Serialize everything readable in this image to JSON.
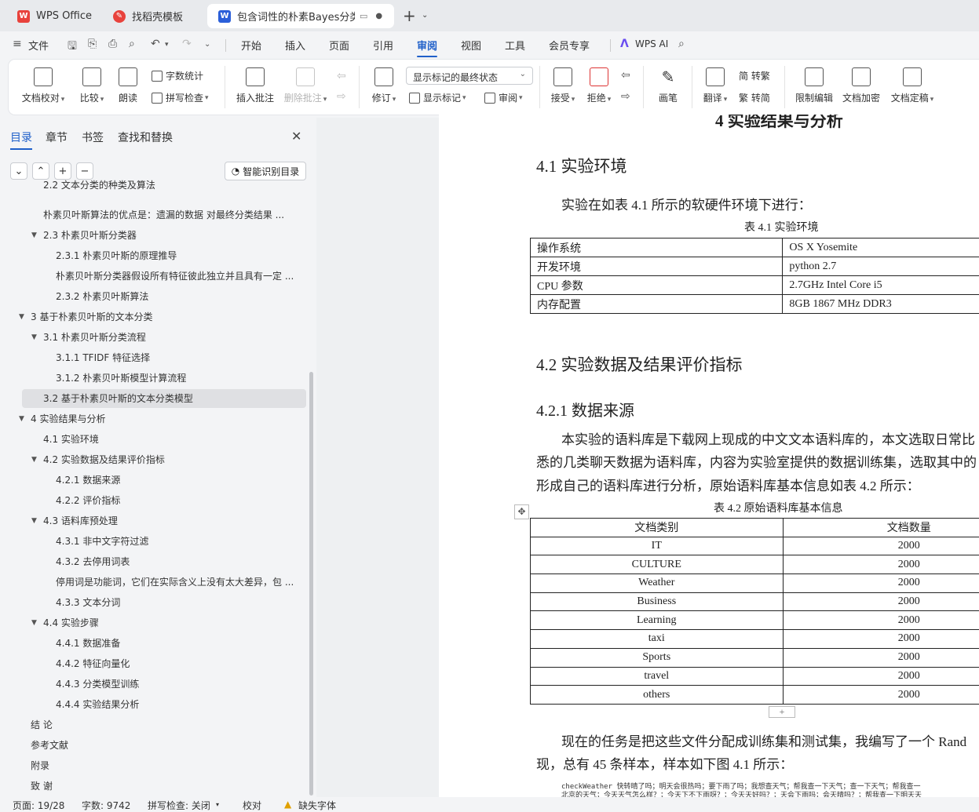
{
  "tabs": [
    {
      "label": "WPS Office"
    },
    {
      "label": "找稻壳模板"
    },
    {
      "label": "包含词性的朴素Bayes分类在文"
    }
  ],
  "menu": {
    "file": "文件",
    "start": "开始",
    "insert": "插入",
    "page": "页面",
    "reference": "引用",
    "review": "审阅",
    "view": "视图",
    "tools": "工具",
    "member": "会员专享",
    "ai": "WPS AI"
  },
  "ribbon": {
    "doc_check": "文档校对",
    "compare": "比较",
    "read": "朗读",
    "word_count": "字数统计",
    "spell_check": "拼写检查",
    "insert_comment": "插入批注",
    "delete_comment": "删除批注",
    "revise": "修订",
    "markup_select": "显示标记的最终状态",
    "show_markup": "显示标记",
    "review_pane": "审阅",
    "accept": "接受",
    "reject": "拒绝",
    "pen": "画笔",
    "translate": "翻译",
    "to_traditional": "简 转繁",
    "to_simplified": "繁 转简",
    "restrict": "限制编辑",
    "encrypt": "文档加密",
    "finalize": "文档定稿"
  },
  "nav": {
    "tabs": [
      "目录",
      "章节",
      "书签",
      "查找和替换"
    ],
    "smart_btn": "智能识别目录",
    "items": [
      {
        "label": "2.2   文本分类的种类及算法"
      },
      {
        "label": "朴素贝叶斯算法的优点是：遗漏的数据    对最终分类结果 ..."
      },
      {
        "label": "2.3  朴素贝叶斯分类器"
      },
      {
        "label": "2.3.1    朴素贝叶斯的原理推导"
      },
      {
        "label": "朴素贝叶斯分类器假设所有特征彼此独立并且具有一定 ..."
      },
      {
        "label": "2.3.2    朴素贝叶斯算法"
      },
      {
        "label": "3  基于朴素贝叶斯的文本分类"
      },
      {
        "label": "3.1  朴素贝叶斯分类流程"
      },
      {
        "label": "3.1.1 TFIDF 特征选择"
      },
      {
        "label": "3.1.2  朴素贝叶斯模型计算流程"
      },
      {
        "label": "3.2 基于朴素贝叶斯的文本分类模型"
      },
      {
        "label": "4  实验结果与分析"
      },
      {
        "label": "4.1 实验环境"
      },
      {
        "label": "4.2 实验数据及结果评价指标"
      },
      {
        "label": "4.2.1  数据来源"
      },
      {
        "label": "4.2.2  评价指标"
      },
      {
        "label": "4.3 语料库预处理"
      },
      {
        "label": "4.3.1  非中文字符过滤"
      },
      {
        "label": "4.3.2  去停用词表"
      },
      {
        "label": "停用词是功能词，它们在实际含义上没有太大差异，包 ..."
      },
      {
        "label": "4.3.3  文本分词"
      },
      {
        "label": "4.4  实验步骤"
      },
      {
        "label": "4.4.1  数据准备"
      },
      {
        "label": "4.4.2  特征向量化"
      },
      {
        "label": "4.4.3  分类模型训练"
      },
      {
        "label": "4.4.4  实验结果分析"
      },
      {
        "label": "结  论"
      },
      {
        "label": "参考文献"
      },
      {
        "label": "附录"
      },
      {
        "label": "致  谢"
      }
    ]
  },
  "doc": {
    "h1": "4  实验结果与分析",
    "h41": "4.1 实验环境",
    "p1": "实验在如表 4.1 所示的软硬件环境下进行：",
    "cap1": "表 4.1    实验环境",
    "table1": [
      [
        "操作系统",
        "OS X Yosemite"
      ],
      [
        "开发环境",
        "python 2.7"
      ],
      [
        "CPU 参数",
        "2.7GHz Intel Core i5"
      ],
      [
        "内存配置",
        "8GB 1867 MHz DDR3"
      ]
    ],
    "h42": "4.2 实验数据及结果评价指标",
    "h421": "4.2.1  数据来源",
    "p2a": "本实验的语料库是下载网上现成的中文文本语料库的，本文选取日常比",
    "p2b": "悉的几类聊天数据为语料库，内容为实验室提供的数据训练集，选取其中的",
    "p2c": "形成自己的语料库进行分析，原始语料库基本信息如表 4.2 所示：",
    "cap2": "表 4.2    原始语料库基本信息",
    "table2_head": [
      "文档类别",
      "文档数量"
    ],
    "table2": [
      [
        "IT",
        "2000"
      ],
      [
        "CULTURE",
        "2000"
      ],
      [
        "Weather",
        "2000"
      ],
      [
        "Business",
        "2000"
      ],
      [
        "Learning",
        "2000"
      ],
      [
        "taxi",
        "2000"
      ],
      [
        "Sports",
        "2000"
      ],
      [
        "travel",
        "2000"
      ],
      [
        "others",
        "2000"
      ]
    ],
    "p3a": "现在的任务是把这些文件分配成训练集和测试集，我编写了一个 Rand",
    "p3b": "现，总有 45 条样本，样本如下图 4.1 所示：",
    "code1": "checkWeather    快转晴了吗；明天会很热吗；要下雨了吗；我想查天气；帮我查一下天气；查一下天气；帮我查一",
    "code2": "北京的天气；今天天气怎么样？；今天下不下雨呀？；今天天好吗？；天会下雨吗；会天晴吗？；帮我查一下明天天"
  },
  "status": {
    "page": "页面: 19/28",
    "words": "字数: 9742",
    "spell": "拼写检查: 关闭",
    "proof": "校对",
    "missing_font": "缺失字体"
  },
  "colors": {
    "accent": "#1f5fc9",
    "wps_red": "#e8423c"
  }
}
